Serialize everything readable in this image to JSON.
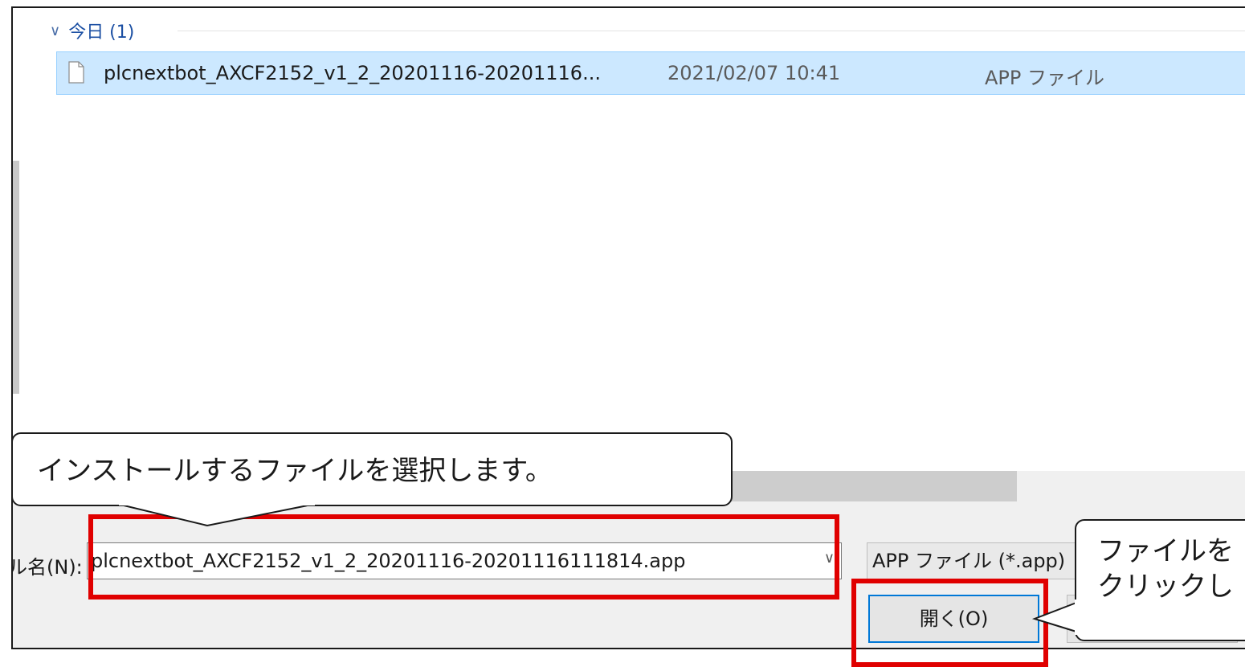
{
  "file_list": {
    "group_header": "今日 (1)",
    "file_row": {
      "name": "plcnextbot_AXCF2152_v1_2_20201116-20201116...",
      "date_modified": "2021/02/07 10:41",
      "type": "APP ファイル"
    }
  },
  "footer": {
    "filename_label": "ル名(N):",
    "filename_value": "plcnextbot_AXCF2152_v1_2_20201116-20201116111814.app",
    "filetype_selected": "APP ファイル (*.app)",
    "open_button_label": "開く(O)",
    "cancel_button_label": ""
  },
  "annotations": {
    "callout_select_file": "インストールするファイルを選択します。",
    "callout_click_line1": "ファイルを",
    "callout_click_line2": "クリックし",
    "highlight_color": "#e00000"
  },
  "colors": {
    "selection_bg": "#cce8ff",
    "selection_border": "#99d1ff",
    "accent": "#0078d7",
    "group_header_text": "#1b4fa3"
  }
}
